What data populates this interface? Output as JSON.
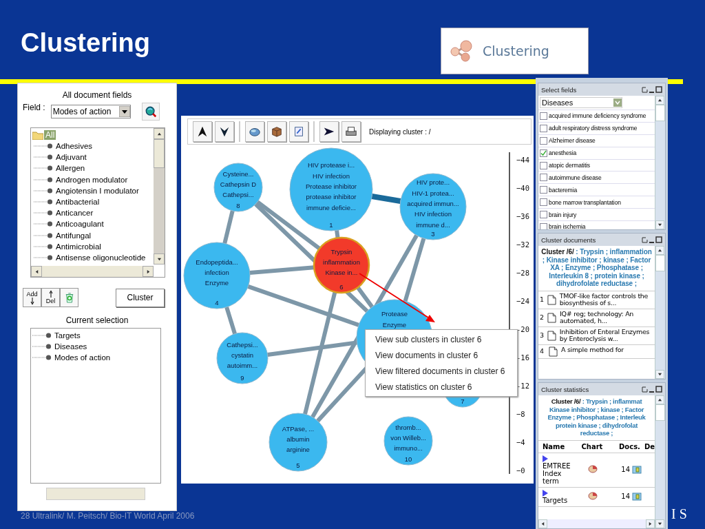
{
  "slide": {
    "title": "Clustering",
    "footer": "28 Ultralink/ M. Peitsch/ Bio-IT World April 2006",
    "corner_text": "I S"
  },
  "badge": {
    "label": "Clustering"
  },
  "fields_panel": {
    "heading": "All document fields",
    "field_label": "Field :",
    "field_value": "Modes of action",
    "tree": {
      "label": "All",
      "selected": true,
      "children": [
        {
          "label": "Adhesives"
        },
        {
          "label": "Adjuvant"
        },
        {
          "label": "Allergen"
        },
        {
          "label": "Androgen modulator"
        },
        {
          "label": "Angiotensin I modulator"
        },
        {
          "label": "Antibacterial"
        },
        {
          "label": "Anticancer"
        },
        {
          "label": "Anticoagulant"
        },
        {
          "label": "Antifungal"
        },
        {
          "label": "Antimicrobial"
        },
        {
          "label": "Antisense oligonucleotide"
        }
      ]
    },
    "add_label": "Add",
    "del_label": "Del",
    "cluster_label": "Cluster",
    "selection_heading": "Current selection",
    "selection": [
      "Targets",
      "Diseases",
      "Modes of action"
    ]
  },
  "graph_panel": {
    "toolbar": [
      [
        {
          "kind": "up"
        },
        {
          "kind": "down"
        }
      ],
      [
        {
          "kind": "sphere"
        },
        {
          "kind": "box"
        },
        {
          "kind": "edit"
        }
      ],
      [
        {
          "kind": "play"
        },
        {
          "kind": "print"
        }
      ]
    ],
    "status": "Displaying cluster : /",
    "nodes": [
      {
        "number": "8",
        "selected": false,
        "lines": [
          "Cysteine...",
          "Cathepsin D",
          "Cathepsi..."
        ]
      },
      {
        "number": "1",
        "selected": false,
        "lines": [
          "HIV protease i...",
          "HIV infection",
          "Protease inhibitor",
          "protease inhibitor",
          "immune deficie..."
        ]
      },
      {
        "number": "3",
        "selected": false,
        "lines": [
          "HIV prote...",
          "HIV-1 protea...",
          "acquired immun...",
          "HIV infection",
          "immune d..."
        ]
      },
      {
        "number": "4",
        "selected": false,
        "lines": [
          "Endopeptida...",
          "infection",
          "Enzyme"
        ]
      },
      {
        "number": "6",
        "selected": true,
        "lines": [
          "Trypsin",
          "inflammation",
          "Kinase in..."
        ]
      },
      {
        "number": "9",
        "selected": false,
        "lines": [
          "Cathepsi...",
          "cystatin",
          "autoimm..."
        ]
      },
      {
        "selected": false,
        "lines": [
          "Protease",
          "Enzyme"
        ]
      },
      {
        "number": "7",
        "selected": false
      },
      {
        "number": "5",
        "selected": false,
        "lines": [
          "ATPase, ...",
          "albumin",
          "arginine"
        ]
      },
      {
        "number": "10",
        "selected": false,
        "lines": [
          "thromb...",
          "von Willeb...",
          "immuno..."
        ]
      }
    ],
    "scale": [
      "−44",
      "−40",
      "−36",
      "−32",
      "−28",
      "−24",
      "-20",
      "-16",
      "-12",
      "−8",
      "−4",
      "−0"
    ],
    "context_menu": [
      "View sub clusters in cluster 6",
      "View documents in cluster 6",
      "View filtered documents in cluster 6",
      "View statistics on cluster 6"
    ]
  },
  "select_fields": {
    "title": "Select fields",
    "dropdown": "Diseases",
    "options": [
      {
        "label": "acquired immune deficiency syndrome",
        "checked": false
      },
      {
        "label": "adult respiratory distress syndrome",
        "checked": false
      },
      {
        "label": "Alzheimer disease",
        "checked": false
      },
      {
        "label": "anesthesia",
        "checked": true
      },
      {
        "label": "atopic dermatitis",
        "checked": false
      },
      {
        "label": "autoimmune disease",
        "checked": false
      },
      {
        "label": "bacteremia",
        "checked": false
      },
      {
        "label": "bone marrow transplantation",
        "checked": false
      },
      {
        "label": "brain injury",
        "checked": false
      },
      {
        "label": "brain ischemia",
        "checked": false
      }
    ]
  },
  "cluster_documents": {
    "title": "Cluster documents",
    "summary": "**Cluster /6/** : Trypsin ; inflammation ; Kinase inhibitor ; kinase ; Factor XA ; Enzyme ; Phosphatase ; Interleukin 8 ; protein kinase ; dihydrofolate reductase ;",
    "documents": [
      {
        "number": "1",
        "title": "TMOF-like factor controls the biosynthesis of s..."
      },
      {
        "number": "2",
        "title": "IQ# reg; technology: An automated, h..."
      },
      {
        "number": "3",
        "title": "Inhibition of Enteral Enzymes by Enteroclysis w..."
      },
      {
        "number": "4",
        "title": "A simple method for"
      }
    ]
  },
  "cluster_statistics": {
    "title": "Cluster statistics",
    "summary_lines": [
      "**Cluster /6/** : Trypsin ; inflammat",
      "Kinase inhibitor ; kinase ; Factor",
      "Enzyme ; Phosphatase ; Interleuk",
      "protein kinase ; dihydrofolat",
      "reductase ;"
    ],
    "columns": [
      "Name",
      "Chart",
      "Docs.",
      "De"
    ],
    "rows": [
      {
        "name": "EMTREE Index term",
        "docs": "14"
      },
      {
        "name": "Targets",
        "docs": "14"
      }
    ]
  }
}
